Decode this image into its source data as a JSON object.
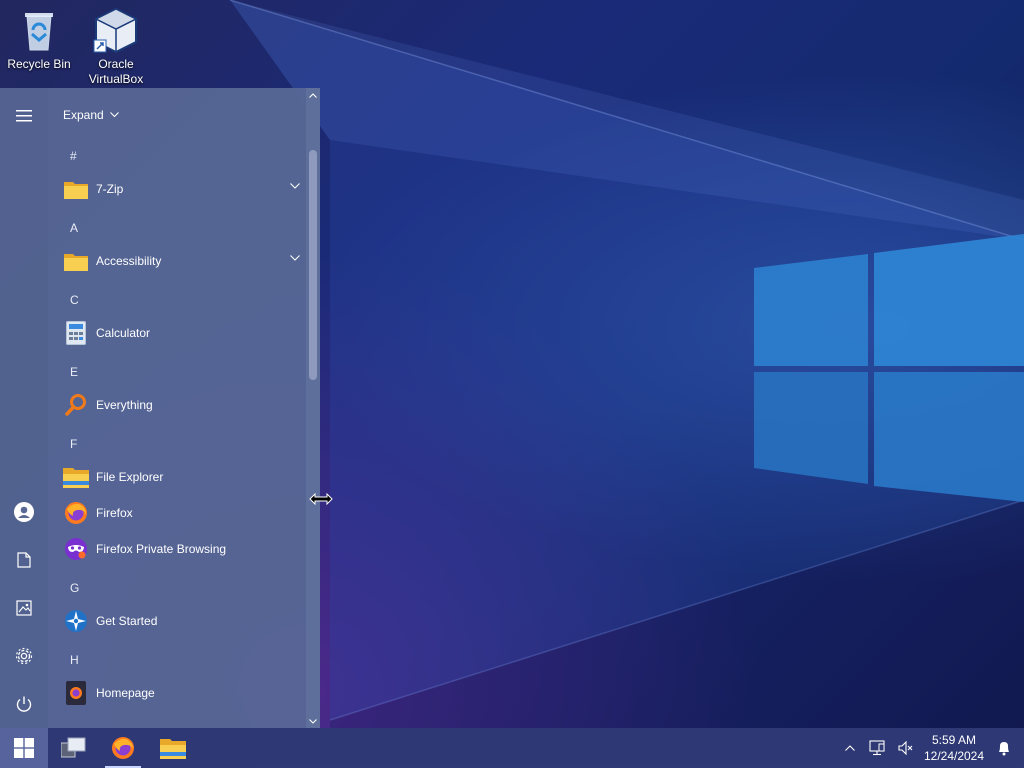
{
  "desktop": {
    "icons": [
      {
        "label": "Recycle Bin",
        "icon": "recycle-bin-icon"
      },
      {
        "label": "Oracle VirtualBox",
        "icon": "virtualbox-icon"
      }
    ]
  },
  "start_menu": {
    "expand_label": "Expand",
    "rail": [
      {
        "name": "hamburger-menu",
        "icon": "menu-icon"
      },
      {
        "name": "user-account",
        "icon": "user-icon"
      },
      {
        "name": "documents",
        "icon": "document-icon"
      },
      {
        "name": "pictures",
        "icon": "picture-icon"
      },
      {
        "name": "settings",
        "icon": "gear-icon"
      },
      {
        "name": "power",
        "icon": "power-icon"
      }
    ],
    "groups": [
      {
        "letter": "#",
        "apps": [
          {
            "label": "7-Zip",
            "icon": "folder-icon",
            "expandable": true
          }
        ]
      },
      {
        "letter": "A",
        "apps": [
          {
            "label": "Accessibility",
            "icon": "folder-icon",
            "expandable": true
          }
        ]
      },
      {
        "letter": "C",
        "apps": [
          {
            "label": "Calculator",
            "icon": "calculator-icon",
            "expandable": false
          }
        ]
      },
      {
        "letter": "E",
        "apps": [
          {
            "label": "Everything",
            "icon": "magnifier-icon",
            "expandable": false
          }
        ]
      },
      {
        "letter": "F",
        "apps": [
          {
            "label": "File Explorer",
            "icon": "file-explorer-icon",
            "expandable": false
          },
          {
            "label": "Firefox",
            "icon": "firefox-icon",
            "expandable": false
          },
          {
            "label": "Firefox Private Browsing",
            "icon": "firefox-private-icon",
            "expandable": false
          }
        ]
      },
      {
        "letter": "G",
        "apps": [
          {
            "label": "Get Started",
            "icon": "get-started-icon",
            "expandable": false
          }
        ]
      },
      {
        "letter": "H",
        "apps": [
          {
            "label": "Homepage",
            "icon": "homepage-icon",
            "expandable": false
          }
        ]
      }
    ]
  },
  "taskbar": {
    "pinned": [
      {
        "name": "start-button",
        "icon": "windows-logo-icon"
      },
      {
        "name": "task-view-button",
        "icon": "task-view-icon"
      },
      {
        "name": "firefox-taskbar",
        "icon": "firefox-icon"
      },
      {
        "name": "file-explorer-taskbar",
        "icon": "file-explorer-icon"
      }
    ],
    "tray": {
      "time": "5:59 AM",
      "date": "12/24/2024"
    }
  },
  "colors": {
    "start_menu_bg": "#5a6896",
    "taskbar_bg": "#303a76",
    "accent": "#2f7fd1"
  }
}
